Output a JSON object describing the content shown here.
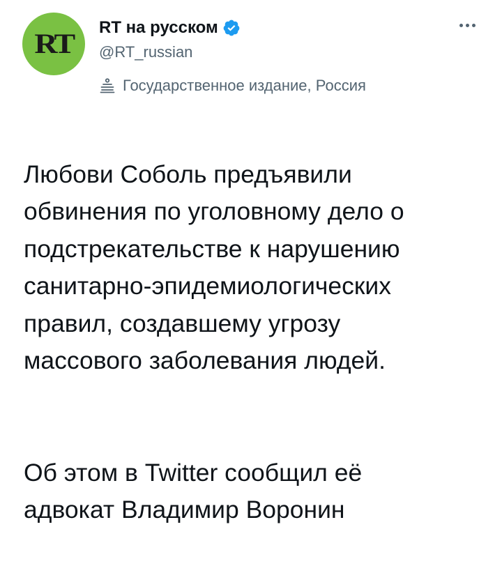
{
  "account": {
    "display_name": "RT на русском",
    "handle": "@RT_russian",
    "avatar_text": "RT",
    "avatar_color": "#7ac143",
    "verified": true,
    "verified_color": "#1d9bf0",
    "label": "Государственное издание, Россия",
    "label_icon": "podium-icon"
  },
  "menu": {
    "more_icon": "more-horizontal-icon"
  },
  "tweet": {
    "paragraphs": [
      "Любови Соболь предъявили\nобвинения по уголовному дело о\nподстрекательстве к нарушению\nсанитарно-эпидемиологических\nправил, создавшему угрозу\nмассового заболевания людей.",
      "Об этом в Twitter сообщил её\nадвокат Владимир Воронин"
    ]
  },
  "colors": {
    "text_primary": "#0f1419",
    "text_secondary": "#536471"
  }
}
